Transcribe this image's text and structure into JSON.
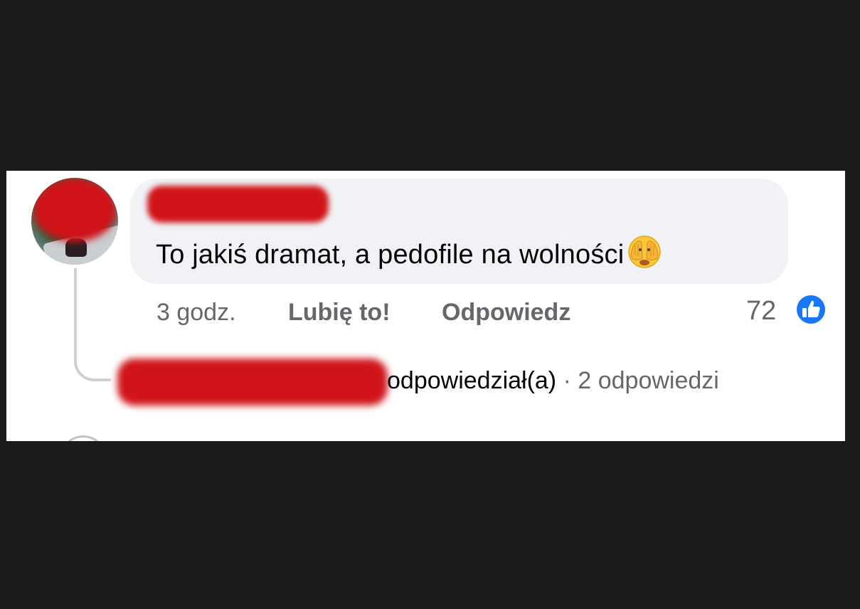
{
  "comment": {
    "author_name": "",
    "text": "To jakiś dramat, a pedofile na wolności",
    "emoji_icon": "face-with-hands-over-eyes-icon",
    "time": "3 godz.",
    "like_label": "Lubię to!",
    "reply_label": "Odpowiedz",
    "reaction_count": "72",
    "reaction_icon": "like-thumb-icon",
    "accent_color": "#1877f2"
  },
  "replies": {
    "replier_name": "",
    "action_text": "odpowiedział(a)",
    "separator": "·",
    "count_text": "2 odpowiedzi"
  }
}
